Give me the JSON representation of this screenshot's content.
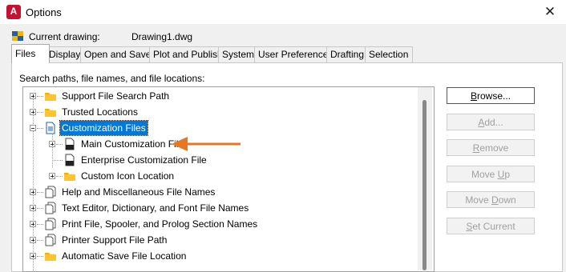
{
  "window": {
    "title": "Options",
    "app_icon": "autocad-icon",
    "close_glyph": "✕"
  },
  "current_drawing": {
    "label": "Current drawing:",
    "value": "Drawing1.dwg"
  },
  "tabs": [
    {
      "label": "Files",
      "active": true
    },
    {
      "label": "Display"
    },
    {
      "label": "Open and Save"
    },
    {
      "label": "Plot and Publish"
    },
    {
      "label": "System"
    },
    {
      "label": "User Preferences"
    },
    {
      "label": "Drafting"
    },
    {
      "label": "Selection"
    }
  ],
  "files_page": {
    "section_label": "Search paths, file names, and file locations:",
    "tree": [
      {
        "label": "Support File Search Path",
        "icon": "folder-icon",
        "expander": "plus"
      },
      {
        "label": "Trusted Locations",
        "icon": "folder-icon",
        "expander": "plus"
      },
      {
        "label": "Customization Files",
        "icon": "document-icon",
        "expander": "minus",
        "selected": true
      },
      {
        "label": "Main Customization File",
        "icon": "cui-file-icon",
        "expander": "plus",
        "child": true
      },
      {
        "label": "Enterprise Customization File",
        "icon": "cui-file-icon",
        "expander": "none",
        "child": true
      },
      {
        "label": "Custom Icon Location",
        "icon": "folder-icon",
        "expander": "plus",
        "child": true
      },
      {
        "label": "Help and Miscellaneous File Names",
        "icon": "multi-document-icon",
        "expander": "plus"
      },
      {
        "label": "Text Editor, Dictionary, and Font File Names",
        "icon": "multi-document-icon",
        "expander": "plus"
      },
      {
        "label": "Print File, Spooler, and Prolog Section Names",
        "icon": "multi-document-icon",
        "expander": "plus"
      },
      {
        "label": "Printer Support File Path",
        "icon": "multi-document-icon",
        "expander": "plus"
      },
      {
        "label": "Automatic Save File Location",
        "icon": "folder-icon",
        "expander": "plus"
      }
    ],
    "buttons": {
      "browse": {
        "mnemonic": "B",
        "rest": "rowse..."
      },
      "add": {
        "mnemonic": "A",
        "rest": "dd..."
      },
      "remove": {
        "mnemonic": "R",
        "rest": "emove"
      },
      "move_up": {
        "pre": "Move ",
        "mnemonic": "U",
        "rest": "p"
      },
      "move_down": {
        "pre": "Move ",
        "mnemonic": "D",
        "rest": "own"
      },
      "set_current": {
        "mnemonic": "S",
        "rest": "et Current"
      }
    }
  },
  "annotation": {
    "arrow_color": "#e87722",
    "icon": "left-arrow-icon"
  }
}
